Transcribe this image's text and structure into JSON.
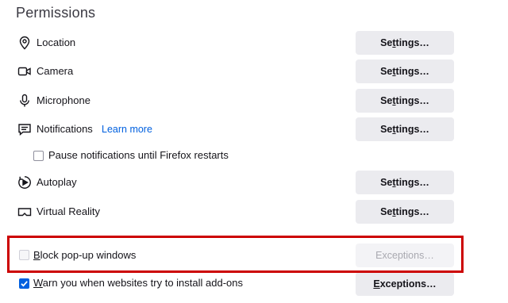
{
  "section": {
    "title": "Permissions"
  },
  "permissions": [
    {
      "label": "Location",
      "button": "Settings…",
      "button_pre": "Se",
      "button_ak": "t",
      "button_post": "tings…",
      "icon": "location-icon"
    },
    {
      "label": "Camera",
      "button": "Settings…",
      "button_pre": "Se",
      "button_ak": "t",
      "button_post": "tings…",
      "icon": "camera-icon"
    },
    {
      "label": "Microphone",
      "button": "Settings…",
      "button_pre": "Se",
      "button_ak": "t",
      "button_post": "tings…",
      "icon": "microphone-icon"
    },
    {
      "label": "Notifications",
      "button": "Settings…",
      "button_pre": "Se",
      "button_ak": "t",
      "button_post": "tings…",
      "icon": "notifications-icon",
      "link": "Learn more"
    },
    {
      "label": "Autoplay",
      "button": "Settings…",
      "button_pre": "Se",
      "button_ak": "t",
      "button_post": "tings…",
      "icon": "autoplay-icon"
    },
    {
      "label": "Virtual Reality",
      "button": "Settings…",
      "button_pre": "Se",
      "button_ak": "t",
      "button_post": "tings…",
      "icon": "vr-headset-icon"
    }
  ],
  "pause_notifications": {
    "label": "Pause notifications until Firefox restarts",
    "checked": false
  },
  "block_popups": {
    "label": "Block pop-up windows",
    "label_ak": "B",
    "label_rest": "lock pop-up windows",
    "checked": false,
    "disabled": true,
    "button": "Exceptions…",
    "button_disabled": true
  },
  "warn_addons": {
    "label": "Warn you when websites try to install add-ons",
    "label_ak": "W",
    "label_rest": "arn you when websites try to install add-ons",
    "checked": true,
    "button": "Exceptions…",
    "button_ak": "E",
    "button_rest": "xceptions…"
  },
  "colors": {
    "accent": "#0060df",
    "highlight": "#cc0000",
    "button_bg": "#ebebef"
  }
}
